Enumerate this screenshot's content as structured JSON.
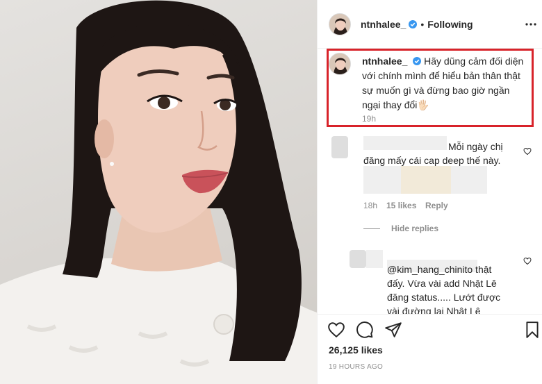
{
  "post": {
    "username": "ntnhalee_",
    "follow_state": "Following",
    "separator": "•",
    "verified": true
  },
  "caption": {
    "username": "ntnhalee_",
    "text": "Hãy dũng cảm đối diện với chính mình để hiểu bản thân thật sự muốn gì và đừng bao giờ ngần ngại thay đổi🖐🏻",
    "time": "19h"
  },
  "comments": [
    {
      "visible_text": "Mỗi ngày chị đăng mấy cái cap deep thế này.",
      "time": "18h",
      "likes": "15 likes",
      "reply_label": "Reply"
    }
  ],
  "hide_replies_label": "Hide replies",
  "reply": {
    "visible_text": "@kim_hang_chinito thật đấy. Vừa vài add Nhật Lê đăng status..... Lướt được vài đường lại Nhật Lê"
  },
  "footer": {
    "likes": "26,125 likes",
    "posted": "19 HOURS AGO"
  },
  "icons": {
    "verified": "verified-badge-icon",
    "more": "more-options-icon",
    "like": "heart-icon",
    "comment": "comment-icon",
    "share": "paper-plane-icon",
    "save": "bookmark-icon"
  },
  "colors": {
    "highlight_border": "#d8232a",
    "verified_blue": "#3897f0",
    "secondary_text": "#8e8e8e"
  }
}
